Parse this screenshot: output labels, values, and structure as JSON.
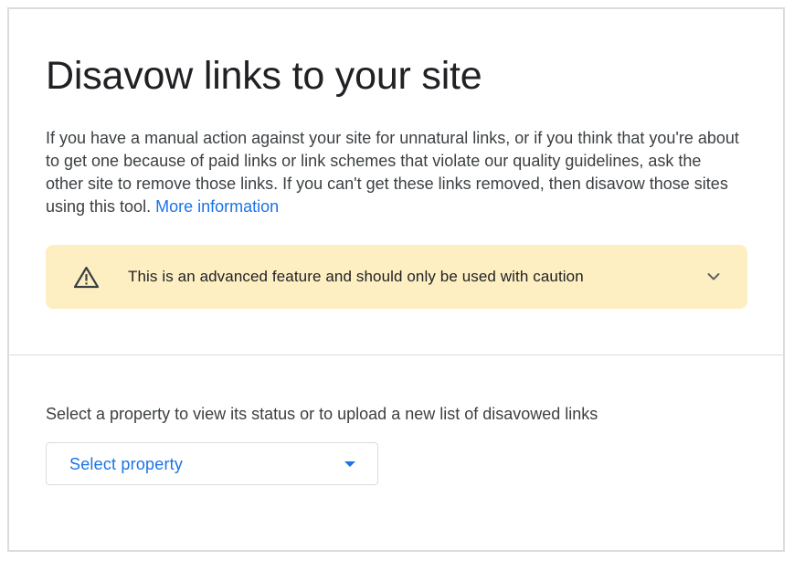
{
  "title": "Disavow links to your site",
  "intro": {
    "text": "If you have a manual action against your site for unnatural links, or if you think that you're about to get one because of paid links or link schemes that violate our quality guidelines, ask the other site to remove those links. If you can't get these links removed, then disavow those sites using this tool. ",
    "link_label": "More information"
  },
  "warning": {
    "icon": "warning-triangle-icon",
    "text": "This is an advanced feature and should only be used with caution",
    "expand_icon": "chevron-down-icon"
  },
  "property_selector": {
    "label": "Select a property to view its status or to upload a new list of disavowed links",
    "placeholder": "Select property",
    "dropdown_icon": "caret-down-icon"
  },
  "colors": {
    "accent": "#1a73e8",
    "warning_background": "#feefc3",
    "border": "#dadce0",
    "text": "#202124"
  }
}
